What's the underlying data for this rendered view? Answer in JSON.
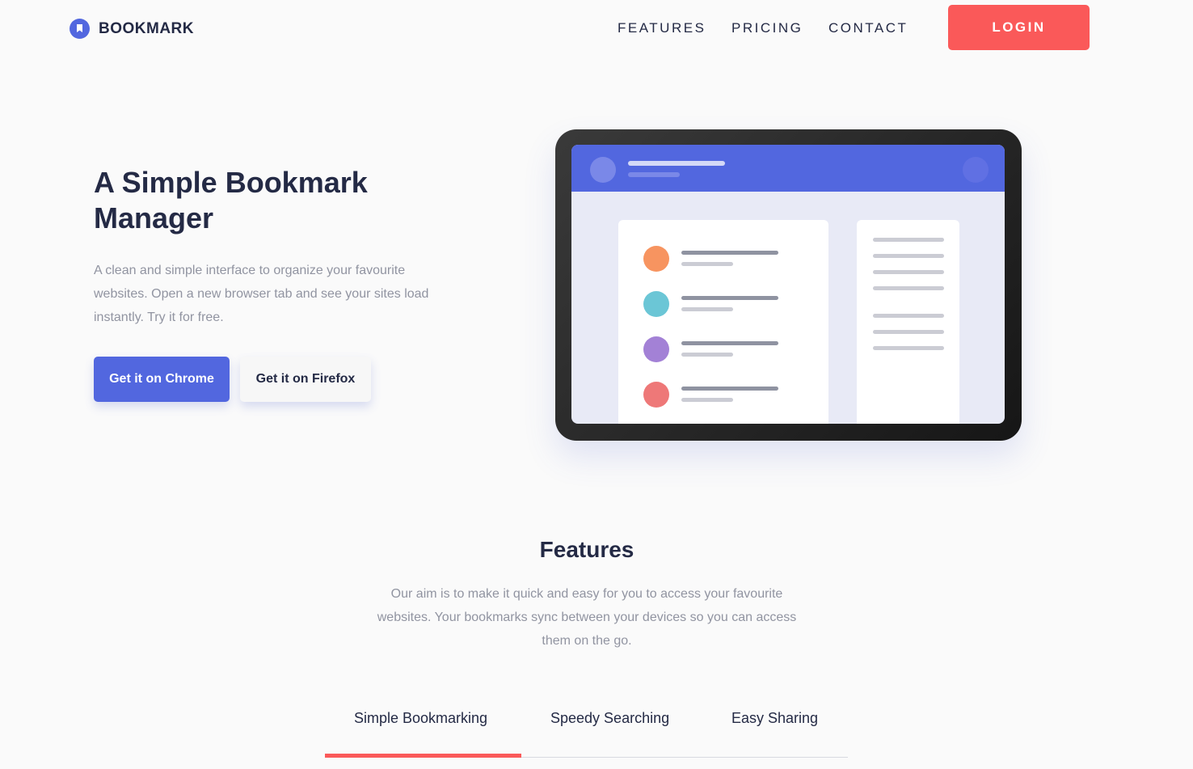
{
  "header": {
    "brand": "BOOKMARK",
    "nav": [
      "FEATURES",
      "PRICING",
      "CONTACT"
    ],
    "login": "LOGIN"
  },
  "hero": {
    "title": "A Simple Bookmark Manager",
    "description": "A clean and simple interface to organize your favourite websites. Open a new browser tab and see your sites load instantly. Try it for free.",
    "chrome_button": "Get it on Chrome",
    "firefox_button": "Get it on Firefox"
  },
  "features": {
    "title": "Features",
    "description": "Our aim is to make it quick and easy for you to access your favourite websites. Your bookmarks sync between your devices so you can access them on the go.",
    "tabs": [
      "Simple Bookmarking",
      "Speedy Searching",
      "Easy Sharing"
    ],
    "active_tab": 0
  },
  "colors": {
    "primary": "#5267df",
    "accent": "#fa5959",
    "dark": "#242a45",
    "grey": "#9194a1",
    "dots": [
      "#f79460",
      "#6bc6d6",
      "#a381d6",
      "#ee7878"
    ]
  }
}
